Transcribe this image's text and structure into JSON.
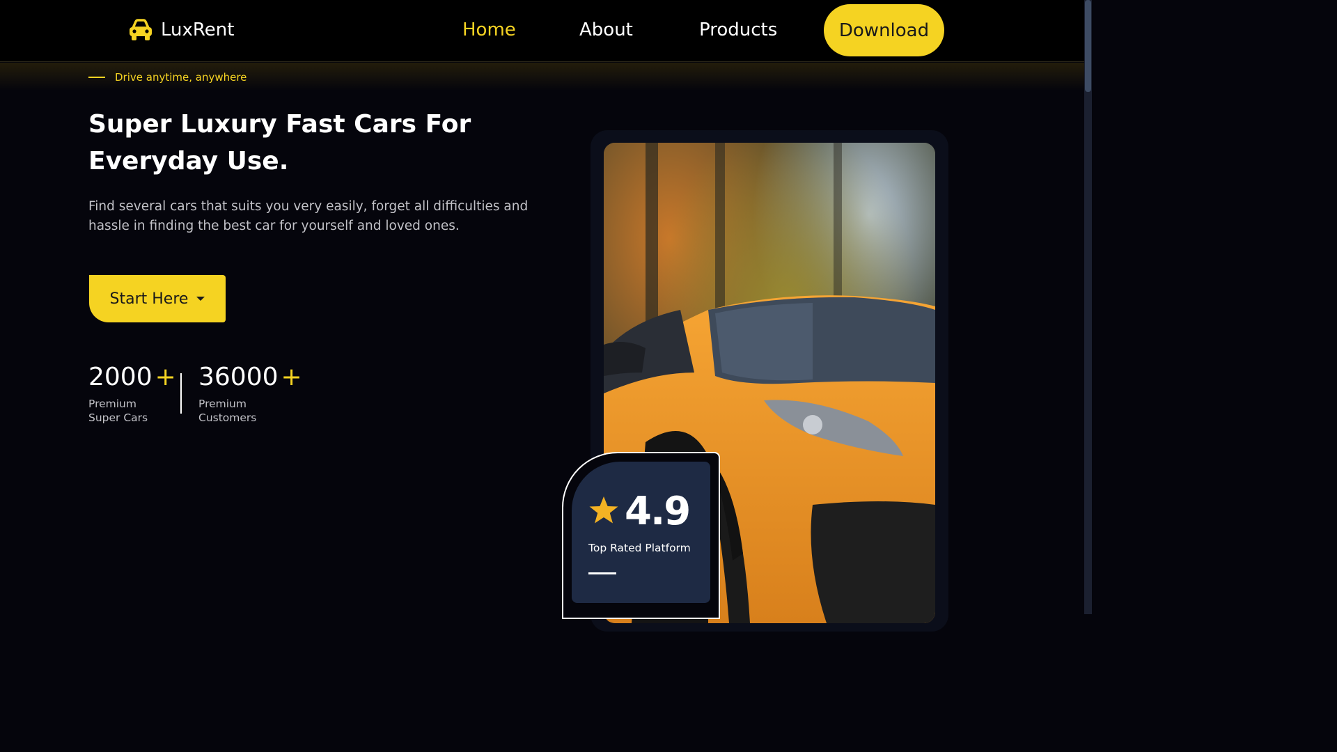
{
  "brand": {
    "name": "LuxRent",
    "icon": "car-icon",
    "accent": "#f5d322"
  },
  "nav": {
    "links": [
      {
        "label": "Home",
        "active": true
      },
      {
        "label": "About",
        "active": false
      },
      {
        "label": "Products",
        "active": false
      }
    ],
    "download_label": "Download"
  },
  "hero": {
    "tagline": "Drive anytime, anywhere",
    "headline": "Super Luxury Fast Cars For Everyday Use.",
    "description": "Find several cars that suits you very easily, forget all difficulties and hassle in finding the best car for yourself and loved ones.",
    "cta_label": "Start Here"
  },
  "stats": [
    {
      "value": "2000",
      "suffix": "+",
      "label_line1": "Premium",
      "label_line2": "Super Cars"
    },
    {
      "value": "36000",
      "suffix": "+",
      "label_line1": "Premium",
      "label_line2": "Customers"
    }
  ],
  "rating": {
    "value": "4.9",
    "label": "Top Rated Platform",
    "icon": "star-icon"
  }
}
